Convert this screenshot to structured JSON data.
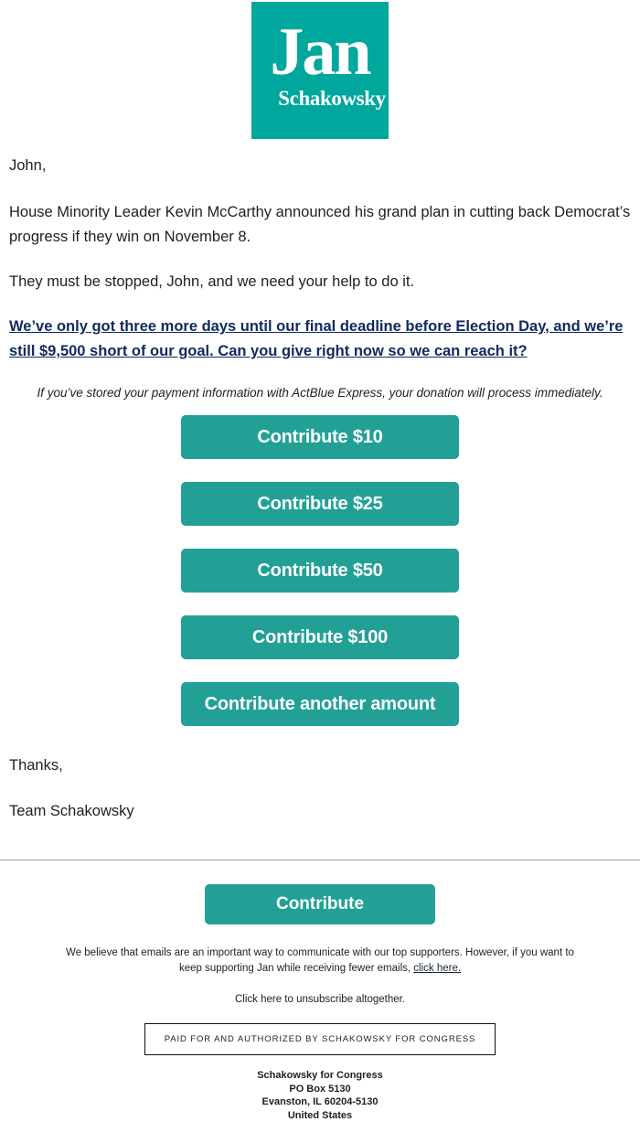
{
  "brand": {
    "accent_teal": "#00a79d",
    "button_teal": "#22a096",
    "link_navy": "#102a5e",
    "logo_first_line": "Jan",
    "logo_second_line": "Schakowsky",
    "logo_alt": "Jan Schakowsky"
  },
  "email": {
    "greeting": "John,",
    "paragraph_1": "House Minority Leader Kevin McCarthy announced his grand plan in cutting back Democrat’s progress if they win on November 8.",
    "paragraph_2": "They must be stopped, John, and we need your help to do it.",
    "ask_link": "We’ve only got three more days until our final deadline before Election Day, and we’re still $9,500 short of our goal. Can you give right now so we can reach it?",
    "express_note": "If you’ve stored your payment information with ActBlue Express, your donation will process immediately.",
    "signoff_thanks": "Thanks,",
    "signoff_team": "Team Schakowsky"
  },
  "donate_buttons": [
    {
      "label": "Contribute $10",
      "amount": "10"
    },
    {
      "label": "Contribute $25",
      "amount": "25"
    },
    {
      "label": "Contribute $50",
      "amount": "50"
    },
    {
      "label": "Contribute $100",
      "amount": "100"
    },
    {
      "label": "Contribute another amount",
      "amount": "other"
    }
  ],
  "footer": {
    "contribute_label": "Contribute",
    "note_part_1": "We believe that emails are an important way to communicate with our top supporters. However, if you want to keep supporting Jan while receiving fewer emails,",
    "note_link": "click here.",
    "unsubscribe": "Click here to unsubscribe altogether.",
    "paid_for": "PAID FOR AND AUTHORIZED BY SCHAKOWSKY FOR CONGRESS",
    "address": {
      "line_1": "Schakowsky for Congress",
      "line_2": "PO Box 5130",
      "line_3": "Evanston, IL 60204-5130",
      "line_4": "United States"
    }
  }
}
